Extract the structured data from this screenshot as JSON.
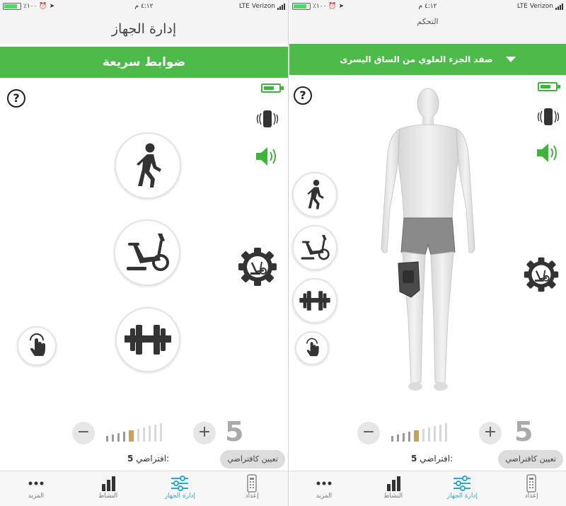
{
  "status_bar": {
    "carrier": "Verizon",
    "network": "LTE",
    "time": "٤:١٢ م",
    "battery_text": "٪١٠٠"
  },
  "left_screen": {
    "nav_title": "إدارة الجهاز",
    "banner": "ضوابط سريعة",
    "help": "?",
    "intensity": {
      "minus": "−",
      "plus": "+",
      "level": "5",
      "active_bar_index": 4,
      "bar_count": 10
    },
    "default_label": "افتراضي:",
    "default_value": "5",
    "set_default_button": "تعيين كافتراضي"
  },
  "right_screen": {
    "nav_title": "التحكم",
    "banner": "صفد الجزء العلوي من الساق اليسرى",
    "help": "?",
    "intensity": {
      "minus": "−",
      "plus": "+",
      "level": "5",
      "active_bar_index": 4,
      "bar_count": 10
    },
    "default_label": "افتراضي:",
    "default_value": "5",
    "set_default_button": "تعيين كافتراضي"
  },
  "tabs": [
    {
      "label": "إعداد",
      "icon": "remote-icon",
      "active": false
    },
    {
      "label": "إدارة الجهاز",
      "icon": "sliders-icon",
      "active": true
    },
    {
      "label": "النشاط",
      "icon": "bar-chart-icon",
      "active": false
    },
    {
      "label": "المزيد",
      "icon": "more-dots-icon",
      "active": false
    }
  ],
  "colors": {
    "accent_green": "#4cbb4a",
    "tab_active": "#2aa9c7",
    "level_active": "#c9a25a"
  }
}
